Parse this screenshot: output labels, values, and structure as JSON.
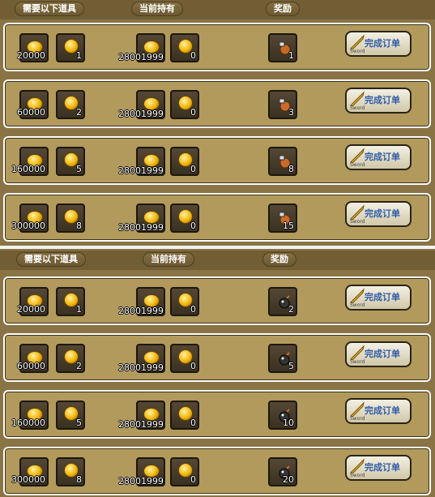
{
  "headers": {
    "required": "需要以下道具",
    "held": "当前持有",
    "reward": "奖励"
  },
  "button": {
    "label": "完成订单",
    "sub": "Sword"
  },
  "top_rows": [
    {
      "req_coin": "20000",
      "req_token": "1",
      "held_coin": "28001999",
      "held_token": "0",
      "reward": "1"
    },
    {
      "req_coin": "60000",
      "req_token": "2",
      "held_coin": "28001999",
      "held_token": "0",
      "reward": "3"
    },
    {
      "req_coin": "160000",
      "req_token": "5",
      "held_coin": "28001999",
      "held_token": "0",
      "reward": "8"
    },
    {
      "req_coin": "300000",
      "req_token": "8",
      "held_coin": "28001999",
      "held_token": "0",
      "reward": "15"
    }
  ],
  "bottom_rows": [
    {
      "req_coin": "20000",
      "req_token": "1",
      "held_coin": "28001999",
      "held_token": "0",
      "reward": "2"
    },
    {
      "req_coin": "60000",
      "req_token": "2",
      "held_coin": "28001999",
      "held_token": "0",
      "reward": "5"
    },
    {
      "req_coin": "160000",
      "req_token": "5",
      "held_coin": "28001999",
      "held_token": "0",
      "reward": "10"
    },
    {
      "req_coin": "300000",
      "req_token": "8",
      "held_coin": "28001999",
      "held_token": "0",
      "reward": "20"
    }
  ],
  "reward_icons": {
    "top": "fist-glove-icon",
    "bottom": "bomb-icon"
  }
}
